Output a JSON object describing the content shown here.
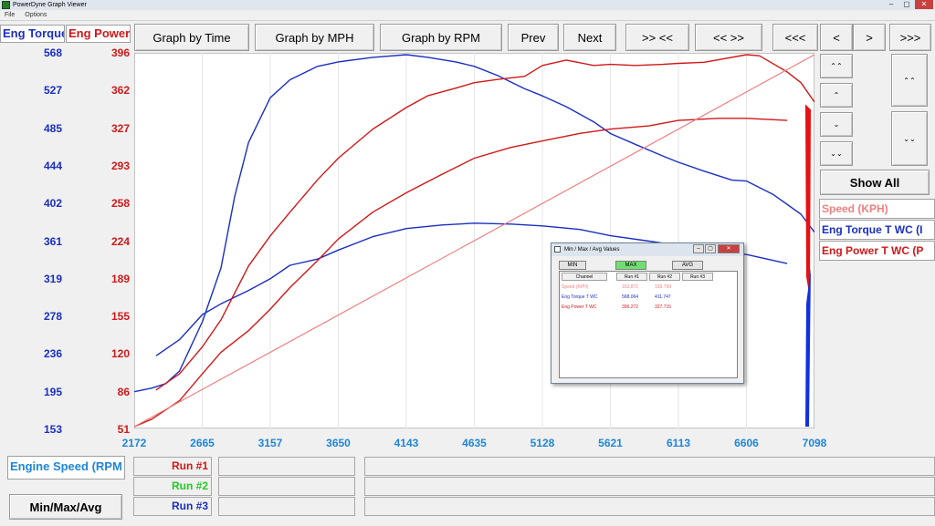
{
  "window": {
    "title": "PowerDyne Graph Viewer",
    "minimize": "–",
    "maximize": "▢",
    "close": "✕"
  },
  "menu": [
    "File",
    "Options"
  ],
  "toolbar": {
    "graph_by_time": "Graph by Time",
    "graph_by_mph": "Graph by MPH",
    "graph_by_rpm": "Graph by RPM",
    "prev": "Prev",
    "next": "Next",
    "zoom_in": ">> <<",
    "zoom_out": "<< >>",
    "first": "<<<",
    "left": "<",
    "right": ">",
    "last": ">>>"
  },
  "axes": {
    "left_label": "Eng Torque",
    "right_label": "Eng Power",
    "torque_ticks": [
      "568",
      "527",
      "485",
      "444",
      "402",
      "361",
      "319",
      "278",
      "236",
      "195",
      "153"
    ],
    "power_ticks": [
      "396",
      "362",
      "327",
      "293",
      "258",
      "224",
      "189",
      "155",
      "120",
      "86",
      "51"
    ],
    "x_ticks": [
      "2172",
      "2665",
      "3157",
      "3650",
      "4143",
      "4635",
      "5128",
      "5621",
      "6113",
      "6606",
      "7098"
    ],
    "x_label": "Engine Speed (RPM"
  },
  "side_buttons": {
    "up_fast": "⌃⌃",
    "up": "⌃",
    "down": "⌄",
    "down_fast": "⌄⌄",
    "tall_up": "⌃⌃",
    "tall_down": "⌄⌄"
  },
  "show_all": "Show All",
  "legend": [
    {
      "label": "Speed (KPH)",
      "color": "#f08080"
    },
    {
      "label": "Eng Torque T WC (I",
      "color": "#1a2fc0"
    },
    {
      "label": "Eng Power T WC (P",
      "color": "#d01818"
    }
  ],
  "runs": [
    {
      "label": "Run #1",
      "color": "#d01818"
    },
    {
      "label": "Run #2",
      "color": "#22cc22"
    },
    {
      "label": "Run #3",
      "color": "#1a2fc0"
    }
  ],
  "min_max_avg_button": "Min/Max/Avg",
  "dialog": {
    "title": "Min / Max / Avg Values",
    "buttons": [
      "MIN",
      "MAX",
      "AVG"
    ],
    "headers": [
      "Channel",
      "Run #1",
      "Run #2",
      "Run #3"
    ],
    "rows": [
      {
        "channel": "Speed (KPH)",
        "run1": "163.871",
        "run2": "159.799",
        "color": "#f08080"
      },
      {
        "channel": "Eng Torque T WC",
        "run1": "568.064",
        "run2": "411.747",
        "color": "#1a2fc0"
      },
      {
        "channel": "Eng Power T WC",
        "run1": "396.272",
        "run2": "327.715",
        "color": "#d01818"
      }
    ]
  },
  "chart_data": {
    "type": "line",
    "x_range": [
      2172,
      7098
    ],
    "torque_range": [
      153,
      568
    ],
    "power_range": [
      51,
      396
    ],
    "series": [
      {
        "axis": "torque",
        "color": "#1a2fc0",
        "x": [
          2172,
          2300,
          2400,
          2500,
          2665,
          2800,
          2900,
          3000,
          3157,
          3300,
          3500,
          3650,
          3900,
          4143,
          4300,
          4500,
          4635,
          4800,
          5000,
          5128,
          5300,
          5500,
          5621,
          5800,
          6000,
          6113,
          6300,
          6500,
          6606,
          6800,
          7000,
          7098
        ],
        "y": [
          192,
          196,
          201,
          215,
          270,
          330,
          410,
          470,
          520,
          540,
          555,
          560,
          565,
          568,
          565,
          560,
          555,
          545,
          530,
          522,
          510,
          493,
          480,
          468,
          455,
          448,
          438,
          428,
          427,
          412,
          390,
          370
        ]
      },
      {
        "axis": "torque",
        "color": "#1a2fc0",
        "x": [
          2330,
          2500,
          2665,
          2800,
          3000,
          3157,
          3300,
          3500,
          3650,
          3900,
          4143,
          4400,
          4635,
          4900,
          5128,
          5400,
          5621,
          5900,
          6113,
          6400,
          6606,
          6900
        ],
        "y": [
          232,
          250,
          278,
          290,
          305,
          318,
          333,
          340,
          350,
          365,
          374,
          378,
          380,
          379,
          377,
          373,
          366,
          360,
          355,
          348,
          345,
          335
        ]
      },
      {
        "axis": "power",
        "color": "#d01818",
        "x": [
          2330,
          2500,
          2665,
          2800,
          3000,
          3157,
          3300,
          3500,
          3650,
          3900,
          4143,
          4300,
          4500,
          4635,
          4800,
          5000,
          5128,
          5300,
          5500,
          5621,
          5800,
          6000,
          6113,
          6300,
          6606,
          6700,
          6900,
          7000,
          7098
        ],
        "y": [
          85,
          100,
          125,
          150,
          200,
          228,
          250,
          280,
          300,
          327,
          347,
          358,
          365,
          370,
          373,
          376,
          386,
          391,
          386,
          387,
          386,
          387,
          388,
          389,
          396,
          395,
          380,
          370,
          352
        ]
      },
      {
        "axis": "power",
        "color": "#d01818",
        "x": [
          2172,
          2300,
          2500,
          2665,
          2800,
          3000,
          3157,
          3300,
          3500,
          3650,
          3900,
          4143,
          4400,
          4635,
          4900,
          5128,
          5400,
          5621,
          5900,
          6113,
          6400,
          6606,
          6900
        ],
        "y": [
          51,
          58,
          75,
          100,
          120,
          140,
          160,
          180,
          205,
          225,
          250,
          268,
          285,
          300,
          310,
          316,
          323,
          327,
          330,
          335,
          337,
          337,
          335
        ]
      },
      {
        "axis": "power",
        "color": "#f08080",
        "x": [
          2172,
          7098
        ],
        "y": [
          51,
          396
        ]
      }
    ]
  }
}
